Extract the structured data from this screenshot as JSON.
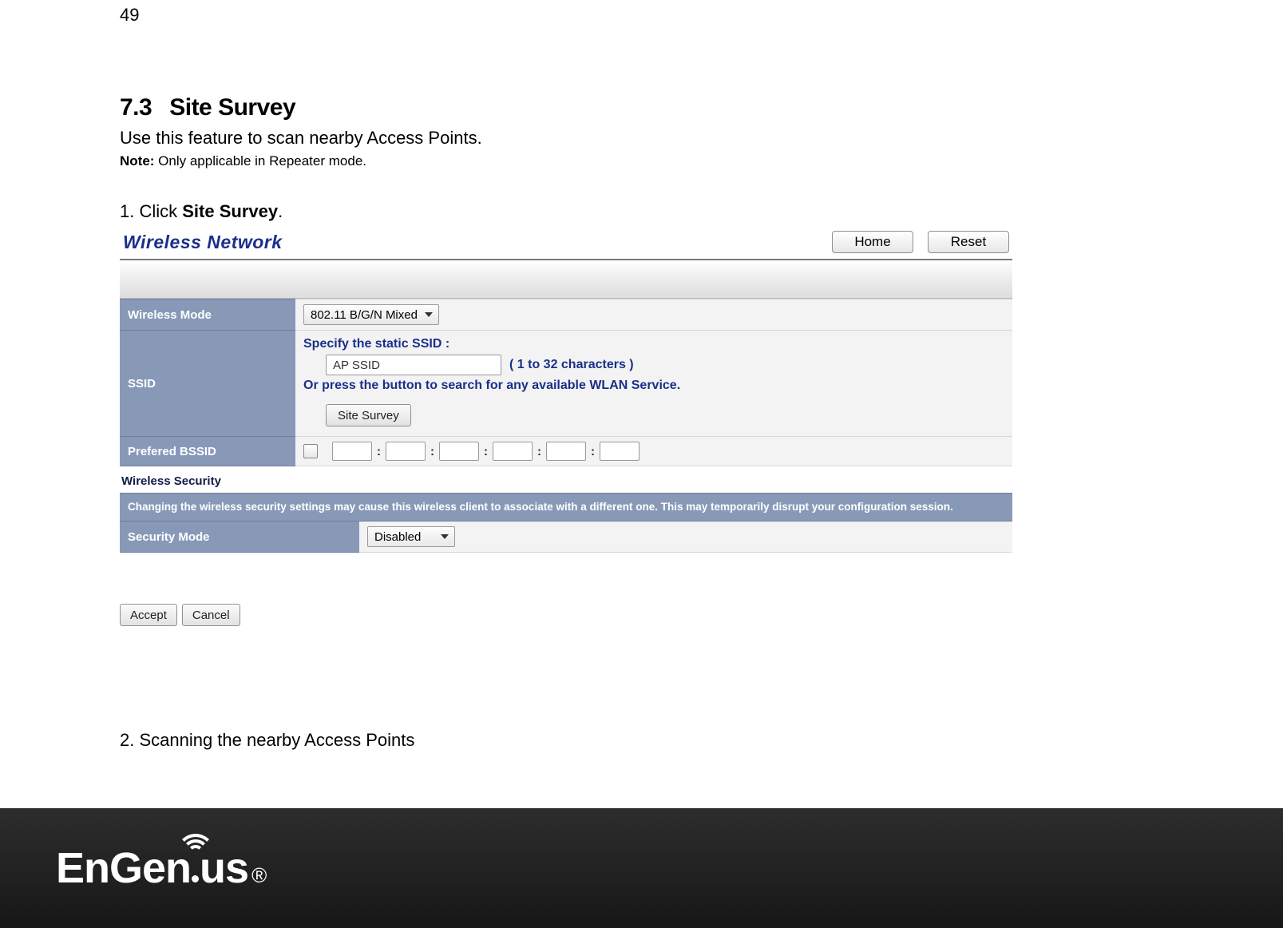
{
  "page_number": "49",
  "section": {
    "number": "7.3",
    "title": "Site Survey"
  },
  "intro": "Use this feature to scan nearby Access Points.",
  "note": {
    "label": "Note:",
    "text": " Only applicable in Repeater mode."
  },
  "step1": {
    "prefix": "1. Click ",
    "bold": "Site Survey",
    "suffix": "."
  },
  "panel": {
    "title": "Wireless Network",
    "home_btn": "Home",
    "reset_btn": "Reset",
    "rows": {
      "wireless_mode": {
        "label": "Wireless Mode",
        "value": "802.11 B/G/N Mixed"
      },
      "ssid": {
        "label": "SSID",
        "specify": "Specify the static SSID  :",
        "input_value": "AP SSID",
        "chars": "( 1 to 32 characters )",
        "or_text": "Or press the button to search for any available WLAN Service.",
        "survey_btn": "Site Survey"
      },
      "bssid": {
        "label": "Prefered BSSID"
      }
    },
    "wireless_security_heading": "Wireless Security",
    "security": {
      "warning": "Changing the wireless security settings may cause this wireless client to associate with a different one. This may temporarily disrupt your configuration session.",
      "mode_label": "Security Mode",
      "mode_value": "Disabled"
    },
    "accept_btn": "Accept",
    "cancel_btn": "Cancel"
  },
  "step2": "2. Scanning the nearby Access Points",
  "logo": {
    "en": "EnGen",
    "ius": "us",
    "reg": "®"
  }
}
